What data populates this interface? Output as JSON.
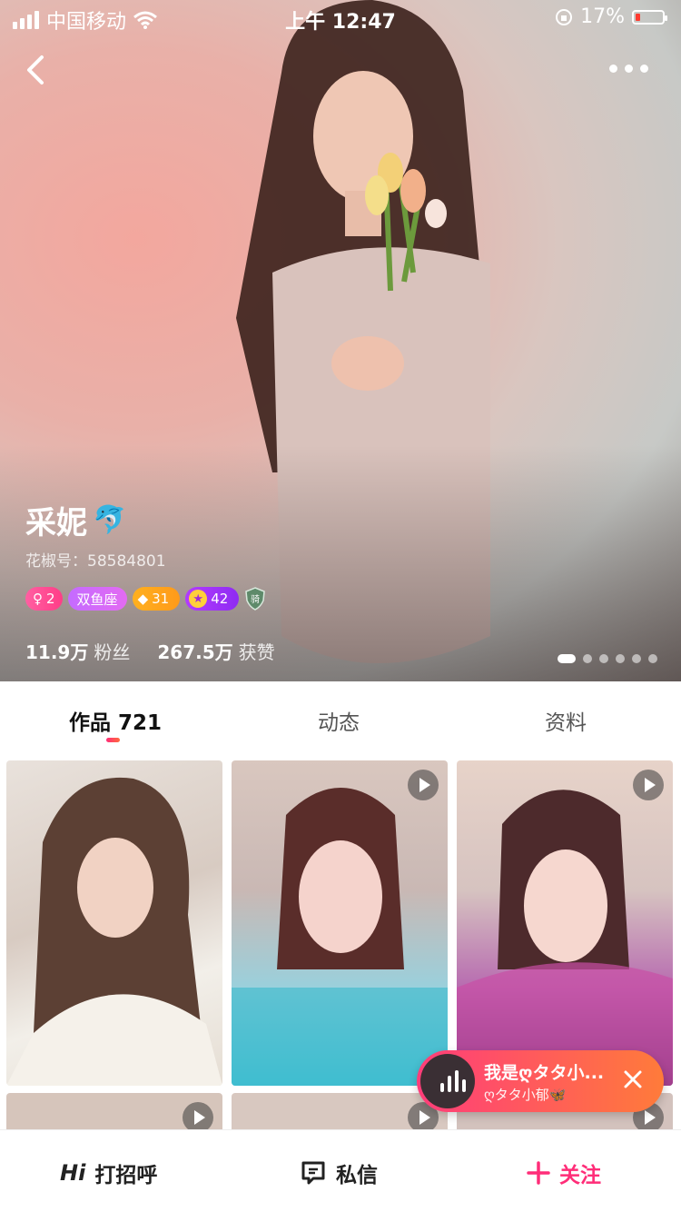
{
  "status_bar": {
    "carrier": "中国移动",
    "time": "上午 12:47",
    "battery_percent": "17%",
    "battery_level": 0.17
  },
  "profile": {
    "name": "采妮",
    "name_emoji": "🐬",
    "id_text": "花椒号：58584801",
    "badges": {
      "gender_level": "2",
      "zodiac": "双鱼座",
      "diamond_level": "31",
      "star_level": "42",
      "shield_text": "骑"
    },
    "stats": [
      {
        "value": "11.9万",
        "label": "粉丝"
      },
      {
        "value": "267.5万",
        "label": "获赞"
      }
    ],
    "photo_pages": 6,
    "photo_active_index": 0
  },
  "tabs": [
    {
      "label": "作品 721",
      "active": true
    },
    {
      "label": "动态",
      "active": false
    },
    {
      "label": "资料",
      "active": false
    }
  ],
  "mini_player": {
    "title": "我是ღタタ小...",
    "subtitle": "ღタタ小郁🦋"
  },
  "bottom_bar": {
    "hi_icon": "Hi",
    "greet_label": "打招呼",
    "message_label": "私信",
    "follow_label": "关注"
  },
  "colors": {
    "accent": "#ff2d78",
    "accent_orange": "#ff7b3a"
  },
  "icons": [
    "back-icon",
    "more-icon",
    "wifi-icon",
    "orientation-lock-icon",
    "play-icon",
    "audio-bars-icon",
    "close-icon",
    "message-icon",
    "plus-icon"
  ]
}
